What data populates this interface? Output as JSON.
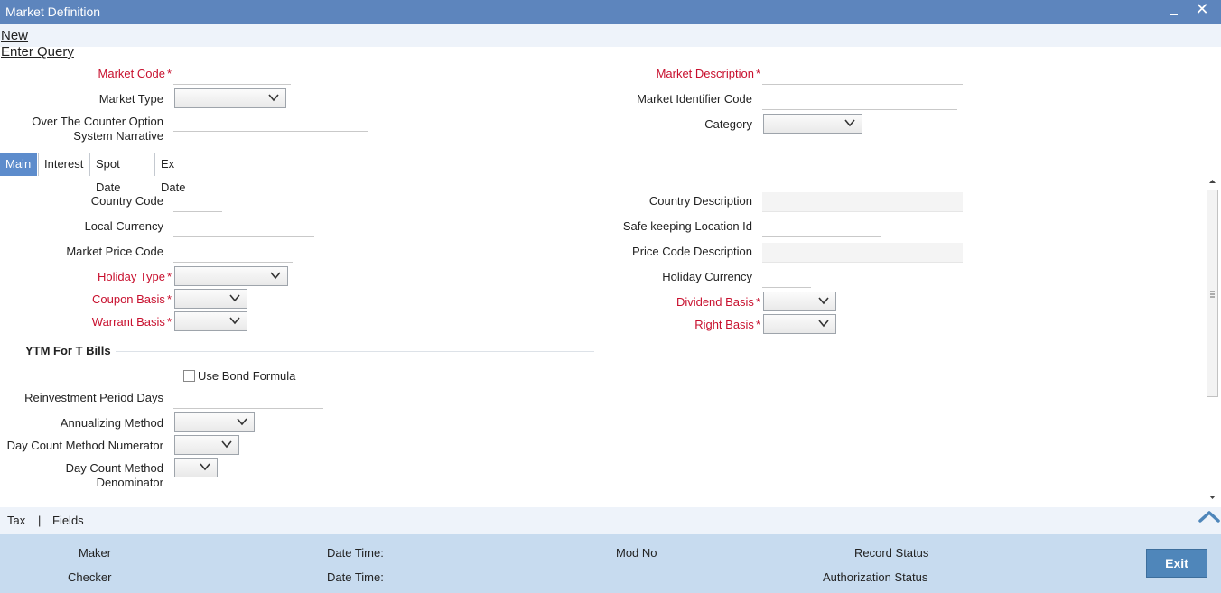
{
  "window": {
    "title": "Market Definition",
    "minimize_icon": "minimize-icon",
    "close_icon": "close-icon",
    "close_glyph": "✕"
  },
  "actions": {
    "new": "New",
    "enter_query": "Enter Query"
  },
  "header": {
    "market_code": {
      "label": "Market Code",
      "required": "*",
      "value": ""
    },
    "market_description": {
      "label": "Market Description",
      "required": "*",
      "value": ""
    },
    "market_type": {
      "label": "Market Type",
      "value": ""
    },
    "market_identifier_code": {
      "label": "Market Identifier Code",
      "value": ""
    },
    "otc_option_narrative": {
      "label_line1": "Over The Counter Option",
      "label_line2": "System Narrative",
      "value": ""
    },
    "category": {
      "label": "Category",
      "value": ""
    }
  },
  "tabs": [
    {
      "label": "Main",
      "active": true
    },
    {
      "label": "Interest",
      "active": false
    },
    {
      "label": "Spot Date",
      "active": false
    },
    {
      "label": "Ex Date",
      "active": false
    }
  ],
  "main": {
    "country_code": {
      "label": "Country Code",
      "value": ""
    },
    "country_description": {
      "label": "Country Description",
      "value": ""
    },
    "local_currency": {
      "label": "Local Currency",
      "value": ""
    },
    "safekeeping_location": {
      "label": "Safe keeping Location Id",
      "value": ""
    },
    "market_price_code": {
      "label": "Market Price Code",
      "value": ""
    },
    "price_code_description": {
      "label": "Price Code Description",
      "value": ""
    },
    "holiday_type": {
      "label": "Holiday Type",
      "required": "*",
      "value": ""
    },
    "holiday_currency": {
      "label": "Holiday Currency",
      "value": ""
    },
    "coupon_basis": {
      "label": "Coupon Basis",
      "required": "*",
      "value": ""
    },
    "dividend_basis": {
      "label": "Dividend Basis",
      "required": "*",
      "value": ""
    },
    "warrant_basis": {
      "label": "Warrant Basis",
      "required": "*",
      "value": ""
    },
    "right_basis": {
      "label": "Right Basis",
      "required": "*",
      "value": ""
    },
    "ytm_section": "YTM For T Bills",
    "use_bond_formula": {
      "label": "Use Bond Formula",
      "checked": false
    },
    "reinvestment_period_days": {
      "label": "Reinvestment Period Days",
      "value": ""
    },
    "annualizing_method": {
      "label": "Annualizing Method",
      "value": ""
    },
    "day_count_numerator": {
      "label": "Day Count Method Numerator",
      "value": ""
    },
    "day_count_denominator": {
      "label_line1": "Day Count Method",
      "label_line2": "Denominator",
      "value": ""
    }
  },
  "footer_links": {
    "tax": "Tax",
    "separator": "|",
    "fields": "Fields"
  },
  "audit": {
    "maker": "Maker",
    "checker": "Checker",
    "date_time_1": "Date Time:",
    "date_time_2": "Date Time:",
    "mod_no": "Mod No",
    "record_status": "Record Status",
    "authorization_status": "Authorization Status"
  },
  "buttons": {
    "exit": "Exit"
  },
  "colors": {
    "titlebar": "#5d85bd",
    "required": "#c8102e",
    "active_tab": "#5d8ccc",
    "audit_bg": "#c7dbef",
    "exit_button": "#4f86ba"
  }
}
